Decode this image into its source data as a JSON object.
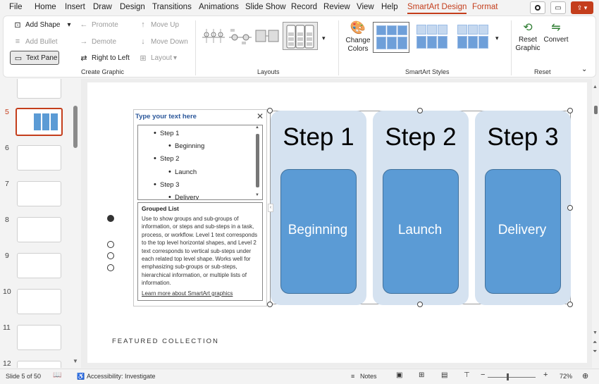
{
  "menu": {
    "items": [
      "File",
      "Home",
      "Insert",
      "Draw",
      "Design",
      "Transitions",
      "Animations",
      "Slide Show",
      "Record",
      "Review",
      "View",
      "Help",
      "SmartArt Design",
      "Format"
    ],
    "active": "SmartArt Design"
  },
  "ribbon": {
    "create_graphic": {
      "label": "Create Graphic",
      "add_shape": "Add Shape",
      "add_bullet": "Add Bullet",
      "text_pane": "Text Pane",
      "promote": "Promote",
      "demote": "Demote",
      "right_to_left": "Right to Left",
      "move_up": "Move Up",
      "move_down": "Move Down",
      "layout": "Layout"
    },
    "layouts": {
      "label": "Layouts"
    },
    "smartart_styles": {
      "label": "SmartArt Styles",
      "change_colors": "Change Colors"
    },
    "reset": {
      "label": "Reset",
      "reset_graphic": "Reset Graphic",
      "convert": "Convert"
    }
  },
  "slides_panel": {
    "items": [
      {
        "num": "5",
        "current": true
      },
      {
        "num": "6"
      },
      {
        "num": "7"
      },
      {
        "num": "8"
      },
      {
        "num": "9"
      },
      {
        "num": "10"
      },
      {
        "num": "11"
      },
      {
        "num": "12"
      }
    ]
  },
  "text_pane": {
    "title": "Type your text here",
    "items": [
      {
        "text": "Step 1",
        "level": 1
      },
      {
        "text": "Beginning",
        "level": 2
      },
      {
        "text": "Step 2",
        "level": 1
      },
      {
        "text": "Launch",
        "level": 2
      },
      {
        "text": "Step 3",
        "level": 1
      },
      {
        "text": "Delivery",
        "level": 2
      }
    ],
    "desc_title": "Grouped List",
    "desc_body": "Use to show groups and sub-groups of information, or steps and sub-steps in a task, process, or workflow. Level 1 text corresponds to the top level horizontal shapes, and Level 2 text corresponds to vertical sub-steps under each related top level shape. Works well for emphasizing sub-groups or sub-steps, hierarchical information, or multiple lists of information.",
    "learn_more": "Learn more about SmartArt graphics"
  },
  "smartart": {
    "columns": [
      {
        "title": "Step 1",
        "sub": "Beginning"
      },
      {
        "title": "Step 2",
        "sub": "Launch"
      },
      {
        "title": "Step 3",
        "sub": "Delivery"
      }
    ],
    "fill_color": "#5b9bd5",
    "group_color": "#d5e2f0"
  },
  "slide_footer": "FEATURED COLLECTION",
  "status": {
    "slide": "Slide 5 of 50",
    "accessibility": "Accessibility: Investigate",
    "notes": "Notes",
    "zoom": "72%"
  },
  "colors": {
    "accent": "#c43e1c"
  }
}
